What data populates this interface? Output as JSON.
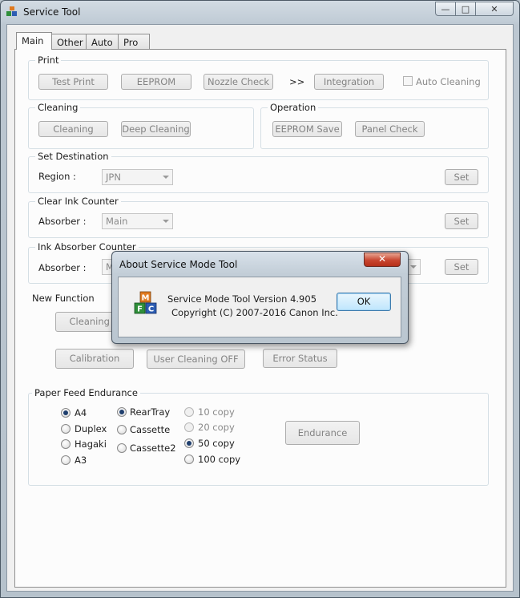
{
  "window": {
    "title": "Service Tool",
    "controls": {
      "minimize": "—",
      "maximize": "□",
      "close": "✕"
    }
  },
  "tabs": [
    {
      "label": "Main",
      "active": true
    },
    {
      "label": "Other"
    },
    {
      "label": "Auto"
    },
    {
      "label": "Pro"
    }
  ],
  "print": {
    "group_label": "Print",
    "test_print": "Test Print",
    "eeprom": "EEPROM",
    "nozzle_check": "Nozzle Check",
    "arrow": ">>",
    "integration": "Integration",
    "auto_cleaning": "Auto Cleaning"
  },
  "cleaning": {
    "group_label": "Cleaning",
    "cleaning": "Cleaning",
    "deep_cleaning": "Deep Cleaning"
  },
  "operation": {
    "group_label": "Operation",
    "eeprom_save": "EEPROM Save",
    "panel_check": "Panel Check"
  },
  "set_destination": {
    "group_label": "Set Destination",
    "region_label": "Region :",
    "region_value": "JPN",
    "set": "Set"
  },
  "clear_ink_counter": {
    "group_label": "Clear Ink Counter",
    "absorber_label": "Absorber :",
    "absorber_value": "Main",
    "set": "Set"
  },
  "ink_absorber_counter": {
    "group_label": "Ink Absorber Counter",
    "absorber_label": "Absorber :",
    "absorber_value": "Ma",
    "set": "Set"
  },
  "new_function": {
    "label": "New Function",
    "cleaning_b": "Cleaning B",
    "calibration": "Calibration",
    "user_cleaning_off": "User Cleaning OFF",
    "error_status": "Error Status"
  },
  "paper_feed": {
    "group_label": "Paper Feed Endurance",
    "sizes": [
      {
        "label": "A4",
        "checked": true
      },
      {
        "label": "Duplex",
        "checked": false
      },
      {
        "label": "Hagaki",
        "checked": false
      },
      {
        "label": "A3",
        "checked": false
      }
    ],
    "trays": [
      {
        "label": "RearTray",
        "checked": true
      },
      {
        "label": "Cassette",
        "checked": false
      },
      {
        "label": "Cassette2",
        "checked": false
      }
    ],
    "copies": [
      {
        "label": "10 copy",
        "checked": false,
        "disabled": true
      },
      {
        "label": "20 copy",
        "checked": false,
        "disabled": true
      },
      {
        "label": "50 copy",
        "checked": true,
        "disabled": false
      },
      {
        "label": "100 copy",
        "checked": false,
        "disabled": false
      }
    ],
    "endurance": "Endurance"
  },
  "about_dialog": {
    "title": "About Service Mode Tool",
    "close": "✕",
    "line1": "Service Mode Tool  Version 4.905",
    "line2": "Copyright (C) 2007-2016 Canon Inc.",
    "ok": "OK",
    "logo_letters": [
      "M",
      "F",
      "C"
    ]
  },
  "colors": {
    "logo_m": "#e07a1f",
    "logo_f": "#2f8f3a",
    "logo_c": "#2d5db3",
    "close_red": "#c8452f"
  }
}
